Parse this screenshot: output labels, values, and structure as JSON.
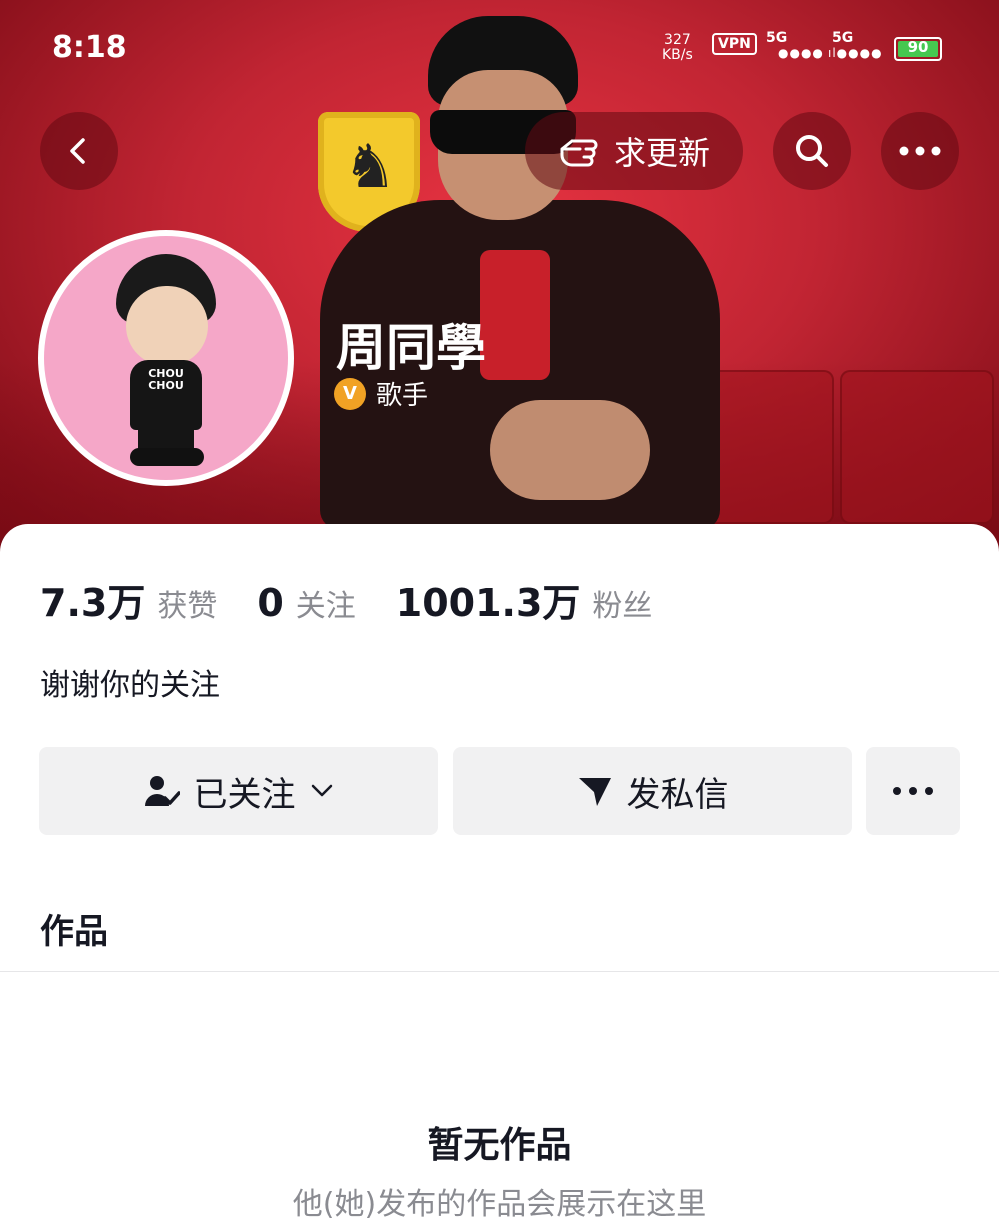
{
  "status_bar": {
    "time": "8:18",
    "net_speed_value": "327",
    "net_speed_unit": "KB/s",
    "vpn": "VPN",
    "signal1": "5G",
    "signal2": "5G",
    "battery": "90"
  },
  "top_actions": {
    "urge_update_label": "求更新",
    "back_icon": "back-chevron-icon",
    "search_icon": "search-icon",
    "more_icon": "more-dots-icon"
  },
  "profile": {
    "name": "周同學",
    "badge_text": "歌手",
    "avatar_shirt_text": "CHOU CHOU"
  },
  "stats": [
    {
      "value": "7.3万",
      "label": "获赞"
    },
    {
      "value": "0",
      "label": "关注"
    },
    {
      "value": "1001.3万",
      "label": "粉丝"
    }
  ],
  "bio": "谢谢你的关注",
  "buttons": {
    "follow_label": "已关注",
    "message_label": "发私信"
  },
  "works": {
    "tab_label": "作品",
    "empty_title": "暂无作品",
    "empty_subtitle": "他(她)发布的作品会展示在这里"
  },
  "colors": {
    "header_red": "#d8202f",
    "badge_gold": "#f1a224",
    "battery_green": "#46c850",
    "text_dark": "#161823",
    "text_gray": "#8a8b91",
    "button_bg": "#f1f1f2"
  }
}
